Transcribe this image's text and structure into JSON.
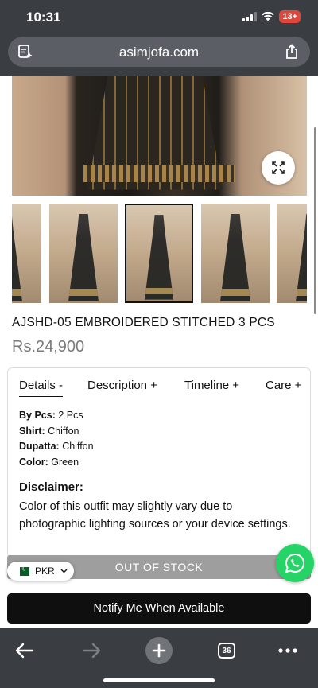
{
  "status_bar": {
    "time": "10:31",
    "battery": "13+"
  },
  "browser": {
    "url": "asimjofa.com",
    "tab_count": "36"
  },
  "product": {
    "title": "AJSHD-05 EMBROIDERED STITCHED 3 PCS",
    "price": "Rs.24,900"
  },
  "tabs": [
    "Details -",
    "Description +",
    "Timeline +",
    "Care +"
  ],
  "details": {
    "pcs_label": "By Pcs:",
    "pcs_value": "2 Pcs",
    "shirt_label": "Shirt:",
    "shirt_value": "Chiffon",
    "dupatta_label": "Dupatta:",
    "dupatta_value": "Chiffon",
    "color_label": "Color:",
    "color_value": "Green",
    "disclaimer_title": "Disclaimer:",
    "disclaimer_text": "Color of this outfit may slightly vary due to photographic lighting sources or your device settings."
  },
  "stock_status": "OUT OF STOCK",
  "currency": "PKR",
  "notify_button": "Notify Me When Available",
  "icons": {
    "reader": "reader-icon",
    "share": "share-icon",
    "zoom": "expand-icon",
    "whatsapp": "whatsapp-icon",
    "back": "back-arrow-icon",
    "forward": "forward-arrow-icon",
    "new_tab": "plus-icon",
    "tabs": "tabs-icon",
    "menu": "more-icon"
  },
  "colors": {
    "chrome": "#3a3d42",
    "whatsapp": "#25d366",
    "out_of_stock": "#9e9e9e",
    "notify": "#0f0f0f"
  }
}
